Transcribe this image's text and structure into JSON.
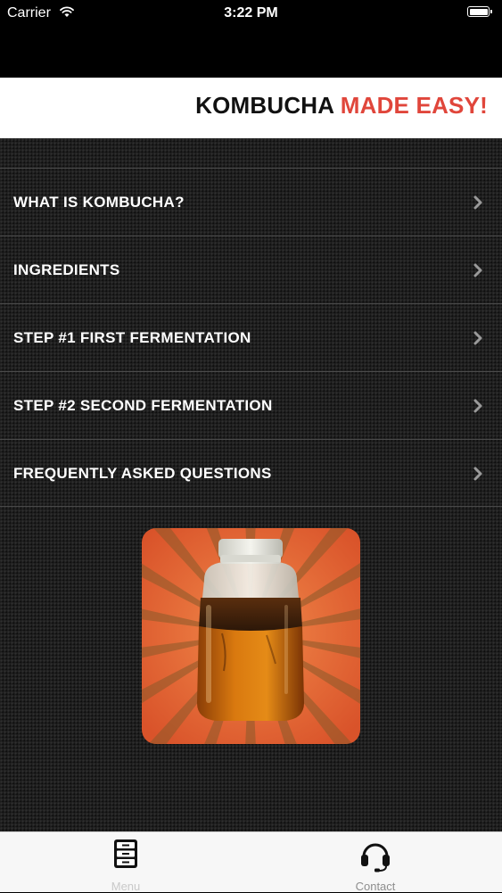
{
  "status_bar": {
    "carrier": "Carrier",
    "time": "3:22 PM",
    "wifi_icon": "wifi-icon",
    "battery_icon": "battery-icon"
  },
  "header": {
    "title_part1": "KOMBUCHA",
    "title_part2": "MADE EASY!",
    "accent_color": "#e0463b"
  },
  "menu": {
    "items": [
      {
        "label": "WHAT IS KOMBUCHA?",
        "icon": "chevron-right-icon"
      },
      {
        "label": "INGREDIENTS",
        "icon": "chevron-right-icon"
      },
      {
        "label": "STEP #1 FIRST FERMENTATION",
        "icon": "chevron-right-icon"
      },
      {
        "label": "STEP #2 SECOND FERMENTATION",
        "icon": "chevron-right-icon"
      },
      {
        "label": "FREQUENTLY ASKED QUESTIONS",
        "icon": "chevron-right-icon"
      }
    ]
  },
  "hero_image": {
    "icon": "kombucha-jar-image"
  },
  "tab_bar": {
    "tabs": [
      {
        "label": "Menu",
        "icon": "file-cabinet-icon",
        "selected": true
      },
      {
        "label": "Contact",
        "icon": "headset-icon",
        "selected": false
      }
    ]
  }
}
